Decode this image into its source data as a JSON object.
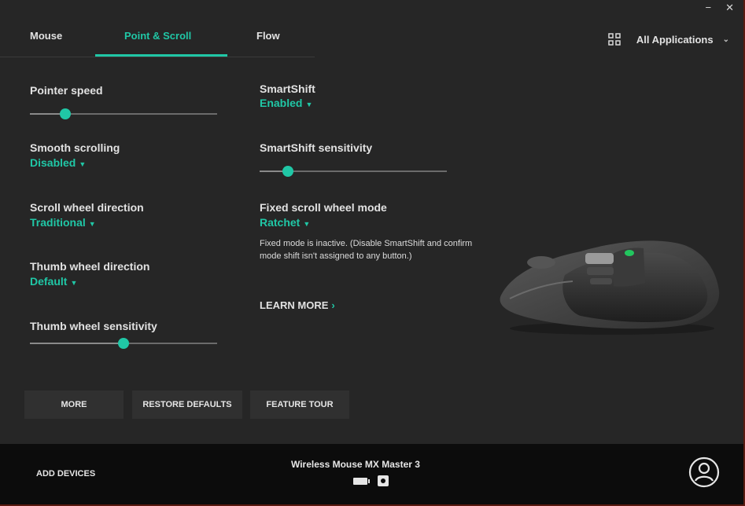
{
  "window": {
    "minimize_glyph": "−",
    "close_glyph": "✕"
  },
  "tabs": [
    {
      "label": "Mouse"
    },
    {
      "label": "Point & Scroll"
    },
    {
      "label": "Flow"
    }
  ],
  "apps_selector": {
    "label": "All Applications",
    "icon": "applications-grid-icon"
  },
  "settings_left": {
    "pointer_speed": {
      "label": "Pointer speed",
      "value_fraction": 0.19
    },
    "smooth_scrolling": {
      "label": "Smooth scrolling",
      "value": "Disabled"
    },
    "scroll_wheel_direction": {
      "label": "Scroll wheel direction",
      "value": "Traditional"
    },
    "thumb_wheel_direction": {
      "label": "Thumb wheel direction",
      "value": "Default"
    },
    "thumb_wheel_sensitivity": {
      "label": "Thumb wheel sensitivity",
      "value_fraction": 0.5
    }
  },
  "settings_right": {
    "smartshift": {
      "label": "SmartShift",
      "value": "Enabled"
    },
    "smartshift_sensitivity": {
      "label": "SmartShift sensitivity",
      "value_fraction": 0.15
    },
    "fixed_scroll_mode": {
      "label": "Fixed scroll wheel mode",
      "value": "Ratchet"
    },
    "note": "Fixed mode is inactive. (Disable SmartShift and confirm mode shift isn't assigned to any button.)",
    "learn_more": "LEARN MORE"
  },
  "buttons": {
    "more": "MORE",
    "restore_defaults": "RESTORE DEFAULTS",
    "feature_tour": "FEATURE TOUR"
  },
  "footer": {
    "add_devices": "ADD DEVICES",
    "device_name": "Wireless Mouse MX Master 3"
  },
  "colors": {
    "accent": "#20c7a6",
    "background": "#262626",
    "footer": "#0c0c0c"
  }
}
